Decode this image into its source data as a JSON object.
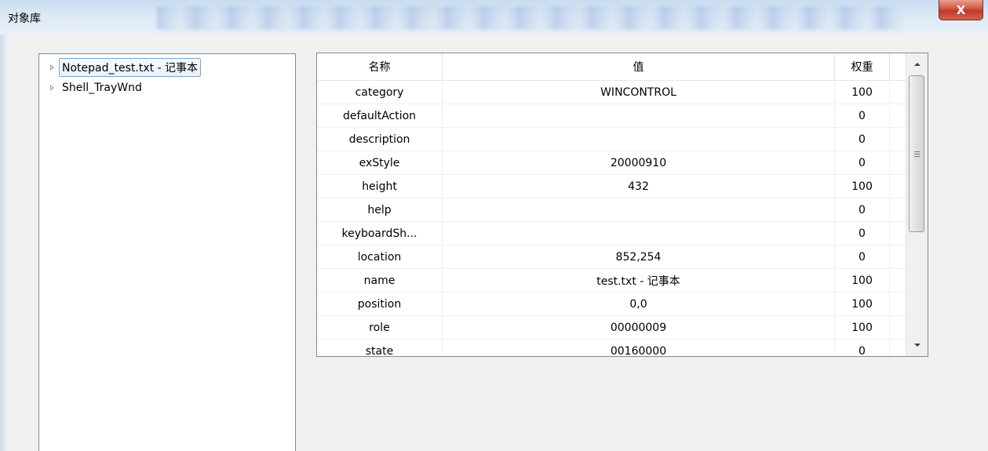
{
  "window": {
    "title": "对象库",
    "close_label": "X"
  },
  "tree": {
    "items": [
      {
        "label": "Notepad_test.txt - 记事本",
        "selected": true
      },
      {
        "label": "Shell_TrayWnd",
        "selected": false
      }
    ]
  },
  "grid": {
    "columns": [
      "名称",
      "值",
      "权重"
    ],
    "rows": [
      {
        "name": "category",
        "value": "WINCONTROL",
        "weight": "100"
      },
      {
        "name": "defaultAction",
        "value": "",
        "weight": "0"
      },
      {
        "name": "description",
        "value": "",
        "weight": "0"
      },
      {
        "name": "exStyle",
        "value": "20000910",
        "weight": "0"
      },
      {
        "name": "height",
        "value": "432",
        "weight": "100"
      },
      {
        "name": "help",
        "value": "",
        "weight": "0"
      },
      {
        "name": "keyboardSh...",
        "value": "",
        "weight": "0"
      },
      {
        "name": "location",
        "value": "852,254",
        "weight": "0"
      },
      {
        "name": "name",
        "value": "test.txt - 记事本",
        "weight": "100"
      },
      {
        "name": "position",
        "value": "0,0",
        "weight": "100"
      },
      {
        "name": "role",
        "value": "00000009",
        "weight": "100"
      },
      {
        "name": "state",
        "value": "00160000",
        "weight": "0"
      }
    ]
  },
  "icons": {
    "close": "close-icon",
    "tree_expand": "expand-arrow-icon",
    "scroll_up": "scroll-up-arrow-icon",
    "scroll_down": "scroll-down-arrow-icon"
  },
  "colors": {
    "title_bar": "#dbe8f5",
    "close_button": "#c0382a",
    "selection_border": "#7da2ce"
  }
}
